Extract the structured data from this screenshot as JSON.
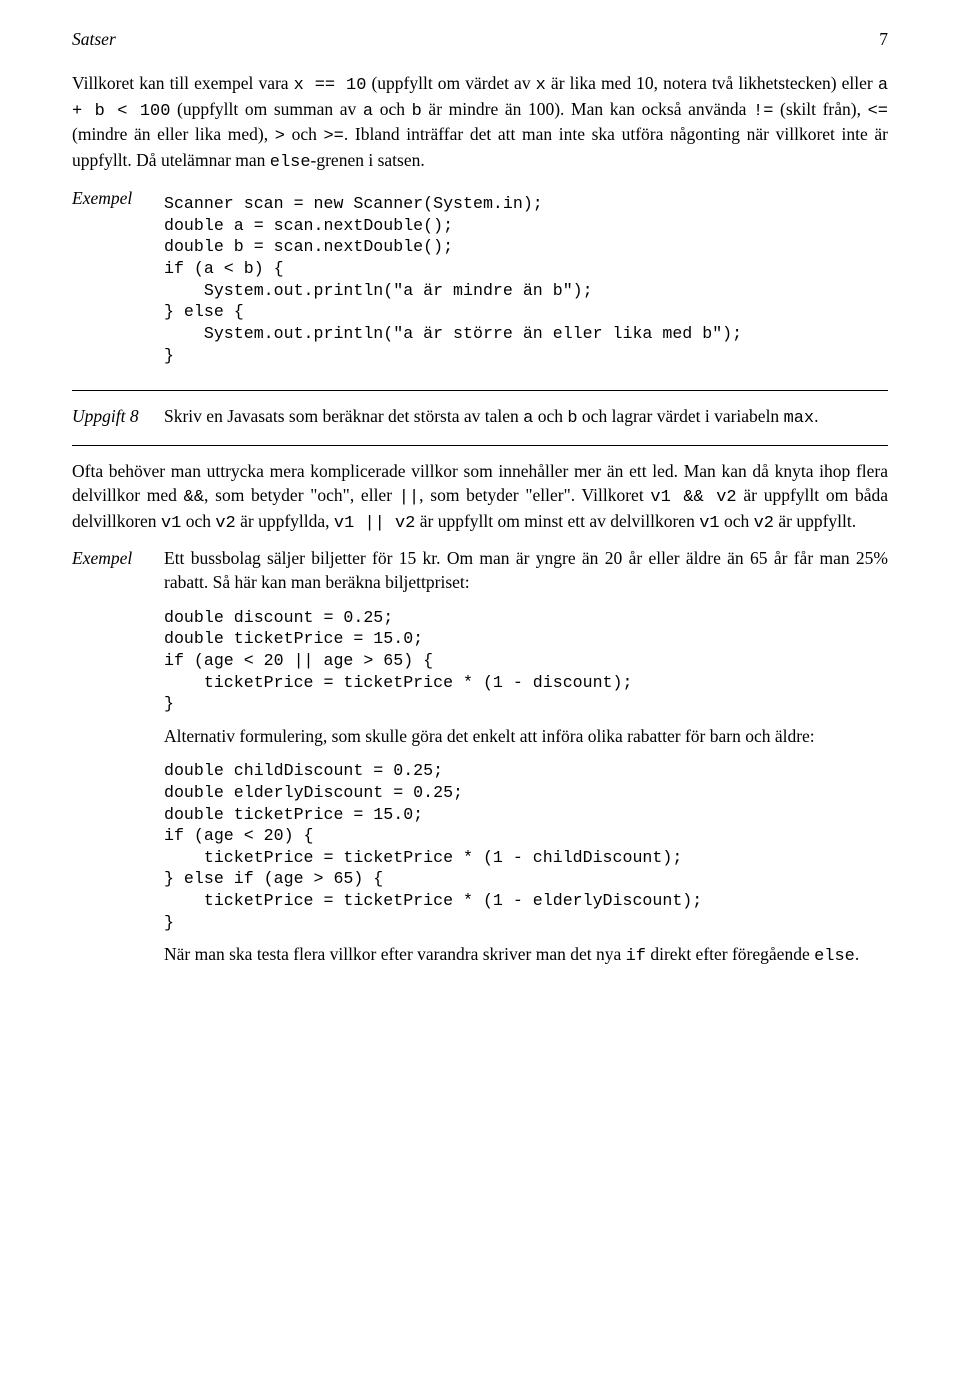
{
  "header": {
    "left": "Satser",
    "right": "7"
  },
  "intro_paragraph": {
    "t1": "Villkoret kan till exempel vara ",
    "c1": "x == 10",
    "t2": " (uppfyllt om värdet av ",
    "c2": "x",
    "t3": " är lika med 10, notera två likhetstecken) eller ",
    "c3": "a + b < 100",
    "t4": " (uppfyllt om summan av ",
    "c4": "a",
    "t5": " och ",
    "c5": "b",
    "t6": " är mindre än 100). Man kan också använda ",
    "c6": "!=",
    "t7": " (skilt från), ",
    "c7": "<=",
    "t8": " (mindre än eller lika med), ",
    "c8": ">",
    "t9": " och ",
    "c9": ">=",
    "t10": ". Ibland inträffar det att man inte ska utföra någonting när villkoret inte är uppfyllt. Då utelämnar man ",
    "c10": "else",
    "t11": "-grenen i satsen."
  },
  "example1": {
    "label": "Exempel",
    "code": "Scanner scan = new Scanner(System.in);\ndouble a = scan.nextDouble();\ndouble b = scan.nextDouble();\nif (a < b) {\n    System.out.println(\"a är mindre än b\");\n} else {\n    System.out.println(\"a är större än eller lika med b\");\n}"
  },
  "uppgift8": {
    "label": "Uppgift 8",
    "t1": "Skriv en Javasats som beräknar det största av talen ",
    "c1": "a",
    "t2": " och ",
    "c2": "b",
    "t3": " och lagrar värdet i variabeln ",
    "c3": "max",
    "t4": "."
  },
  "para2": {
    "t1": "Ofta behöver man uttrycka mera komplicerade villkor som innehåller mer än ett led. Man kan då knyta ihop flera delvillkor med ",
    "c1": "&&",
    "t2": ", som betyder \"och\", eller ",
    "c2": "||",
    "t3": ", som betyder \"eller\". Villkoret ",
    "c3": "v1 && v2",
    "t4": " är uppfyllt om båda delvillkoren ",
    "c4": "v1",
    "t5": " och ",
    "c5": "v2",
    "t6": " är uppfyllda, ",
    "c6": "v1 || v2",
    "t7": " är uppfyllt om minst ett av delvillkoren ",
    "c7": "v1",
    "t8": " och ",
    "c8": "v2",
    "t9": " är uppfyllt."
  },
  "example2": {
    "label": "Exempel",
    "intro": "Ett bussbolag säljer biljetter för 15 kr. Om man är yngre än 20 år eller äldre än 65 år får man 25% rabatt. Så här kan man beräkna biljettpriset:",
    "code1": "double discount = 0.25;\ndouble ticketPrice = 15.0;\nif (age < 20 || age > 65) {\n    ticketPrice = ticketPrice * (1 - discount);\n}",
    "mid": "Alternativ formulering, som skulle göra det enkelt att införa olika rabatter för barn och äldre:",
    "code2": "double childDiscount = 0.25;\ndouble elderlyDiscount = 0.25;\ndouble ticketPrice = 15.0;\nif (age < 20) {\n    ticketPrice = ticketPrice * (1 - childDiscount);\n} else if (age > 65) {\n    ticketPrice = ticketPrice * (1 - elderlyDiscount);\n}",
    "outro_t1": "När man ska testa flera villkor efter varandra skriver man det nya ",
    "outro_c1": "if",
    "outro_t2": " direkt efter föregående ",
    "outro_c2": "else",
    "outro_t3": "."
  }
}
